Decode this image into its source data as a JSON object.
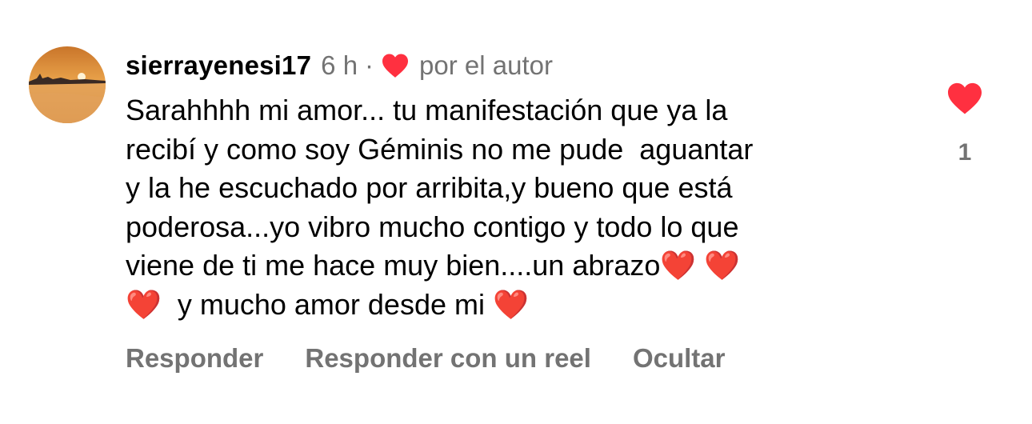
{
  "comment": {
    "username": "sierrayenesi17",
    "time": "6 h",
    "separator": "·",
    "liked_by_author_label": "por el autor",
    "text": "Sarahhhh mi amor... tu manifestación que ya la\nrecibí y como soy Géminis no me pude  aguantar\ny la he escuchado por arribita,y bueno que está\npoderosa...yo vibro mucho contigo y todo lo que\nviene de ti me hace muy bien....un abrazo❤️ ❤️\n❤️  y mucho amor desde mi ❤️",
    "like_count": "1",
    "actions": {
      "reply": "Responder",
      "reply_reel": "Responder con un reel",
      "hide": "Ocultar"
    }
  },
  "colors": {
    "heart_red": "#ff3040",
    "secondary_text": "#737373"
  },
  "icons": {
    "liked_by_author": "heart-icon",
    "like_button": "heart-icon"
  }
}
